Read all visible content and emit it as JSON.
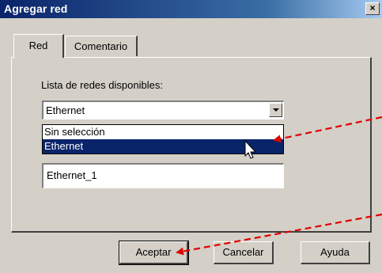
{
  "window": {
    "title": "Agregar red",
    "close_label": "×"
  },
  "tabs": [
    {
      "label": "Red",
      "active": true
    },
    {
      "label": "Comentario",
      "active": false
    }
  ],
  "form": {
    "list_label": "Lista de redes disponibles:",
    "selected_network": "Ethernet",
    "dropdown_options": [
      "Sin selección",
      "Ethernet"
    ],
    "name_value": "Ethernet_1"
  },
  "buttons": {
    "accept": "Aceptar",
    "cancel": "Cancelar",
    "help": "Ayuda"
  },
  "colors": {
    "title_bar": "#0a246a",
    "selection": "#0a246a",
    "annotation_arrow": "#e00000"
  }
}
